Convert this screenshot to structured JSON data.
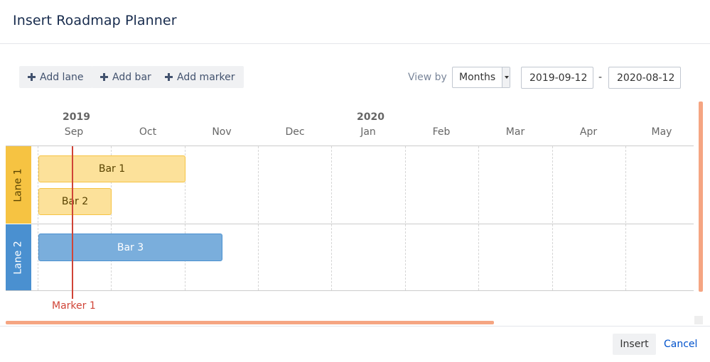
{
  "dialog": {
    "title": "Insert Roadmap Planner"
  },
  "toolbar": {
    "add_lane": "Add lane",
    "add_bar": "Add bar",
    "add_marker": "Add marker",
    "view_by_label": "View by",
    "view_by_value": "Months",
    "start_date": "2019-09-12",
    "date_separator": "-",
    "end_date": "2020-08-12"
  },
  "timeline": {
    "years": [
      "2019",
      "2020"
    ],
    "months": [
      "Sep",
      "Oct",
      "Nov",
      "Dec",
      "Jan",
      "Feb",
      "Mar",
      "Apr",
      "May"
    ]
  },
  "lanes": [
    {
      "name": "Lane 1",
      "color": "#f6c342",
      "text_color": "#594300"
    },
    {
      "name": "Lane 2",
      "color": "#4a90d0",
      "text_color": "#ffffff"
    }
  ],
  "bars": [
    {
      "label": "Bar 1",
      "lane": "Lane 1",
      "color": "#fce19a",
      "border": "#f6c342",
      "text_color": "#594300"
    },
    {
      "label": "Bar 2",
      "lane": "Lane 1",
      "color": "#fce19a",
      "border": "#f6c342",
      "text_color": "#594300"
    },
    {
      "label": "Bar 3",
      "lane": "Lane 2",
      "color": "#7aaedc",
      "border": "#4a90d0",
      "text_color": "#ffffff"
    }
  ],
  "marker": {
    "label": "Marker 1",
    "color": "#d04437"
  },
  "footer": {
    "insert": "Insert",
    "cancel": "Cancel"
  }
}
